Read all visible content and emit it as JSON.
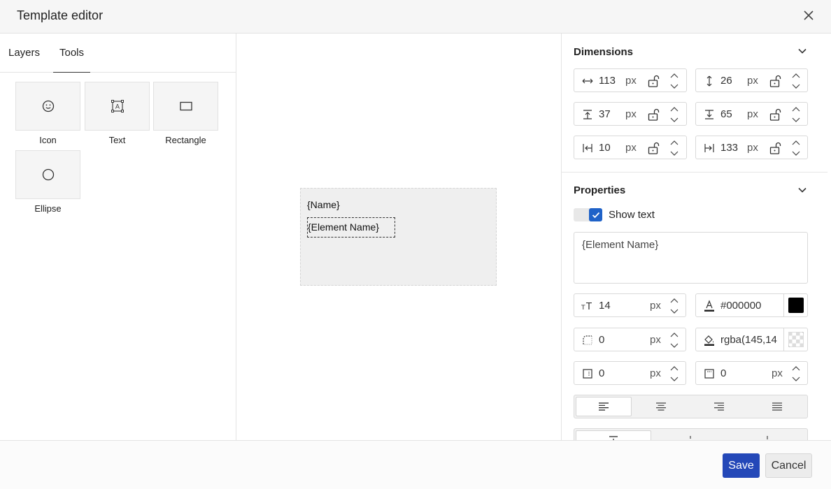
{
  "window": {
    "title": "Template editor"
  },
  "left_panel": {
    "tabs": [
      {
        "label": "Layers"
      },
      {
        "label": "Tools",
        "active": true
      }
    ],
    "tools": [
      {
        "label": "Icon",
        "icon": "smiley-icon"
      },
      {
        "label": "Text",
        "icon": "text-box-icon"
      },
      {
        "label": "Rectangle",
        "icon": "rectangle-icon"
      },
      {
        "label": "Ellipse",
        "icon": "ellipse-icon"
      }
    ]
  },
  "canvas": {
    "name_placeholder": "{Name}",
    "element_name_placeholder": "{Element Name}"
  },
  "dimensions": {
    "title": "Dimensions",
    "width": "113",
    "height": "26",
    "top": "37",
    "bottom": "65",
    "left": "10",
    "right": "133",
    "unit": "px"
  },
  "properties": {
    "title": "Properties",
    "show_text_label": "Show text",
    "show_text_checked": true,
    "text_value": "{Element Name}",
    "font_size": "14",
    "text_color": "#000000",
    "border_radius": "0",
    "background_color": "rgba(145,14",
    "padding_a": "0",
    "padding_b": "0",
    "unit": "px",
    "align_options": [
      "align-left",
      "align-center",
      "align-right",
      "align-justify"
    ],
    "align_selected": "align-left"
  },
  "colors": {
    "accent": "#2448b8",
    "checkbox": "#1f62c8",
    "text_swatch": "#000000"
  },
  "footer": {
    "save_label": "Save",
    "cancel_label": "Cancel"
  }
}
